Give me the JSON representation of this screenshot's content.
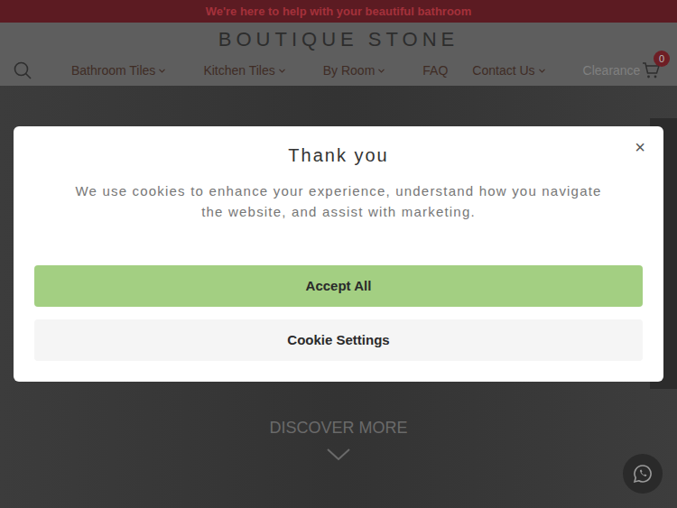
{
  "announcement": "We're here to help with your beautiful bathroom",
  "logo": "BOUTIQUE STONE",
  "nav": [
    {
      "label": "Bathroom Tiles",
      "has_menu": true,
      "highlighted": false
    },
    {
      "label": "Kitchen Tiles",
      "has_menu": true,
      "highlighted": false
    },
    {
      "label": "By Room",
      "has_menu": true,
      "highlighted": false
    },
    {
      "label": "FAQ",
      "has_menu": false,
      "highlighted": false
    },
    {
      "label": "Contact Us",
      "has_menu": true,
      "highlighted": false
    },
    {
      "label": "Clearance",
      "has_menu": false,
      "highlighted": true
    }
  ],
  "cart": {
    "count": "0"
  },
  "hero": {
    "cta": "DISCOVER MORE"
  },
  "cookie_dialog": {
    "title": "Thank you",
    "message": "We use cookies to enhance your experience, understand how you navigate the website, and assist with marketing.",
    "close": "×",
    "buttons": [
      "Accept All",
      "Cookie Settings"
    ]
  }
}
